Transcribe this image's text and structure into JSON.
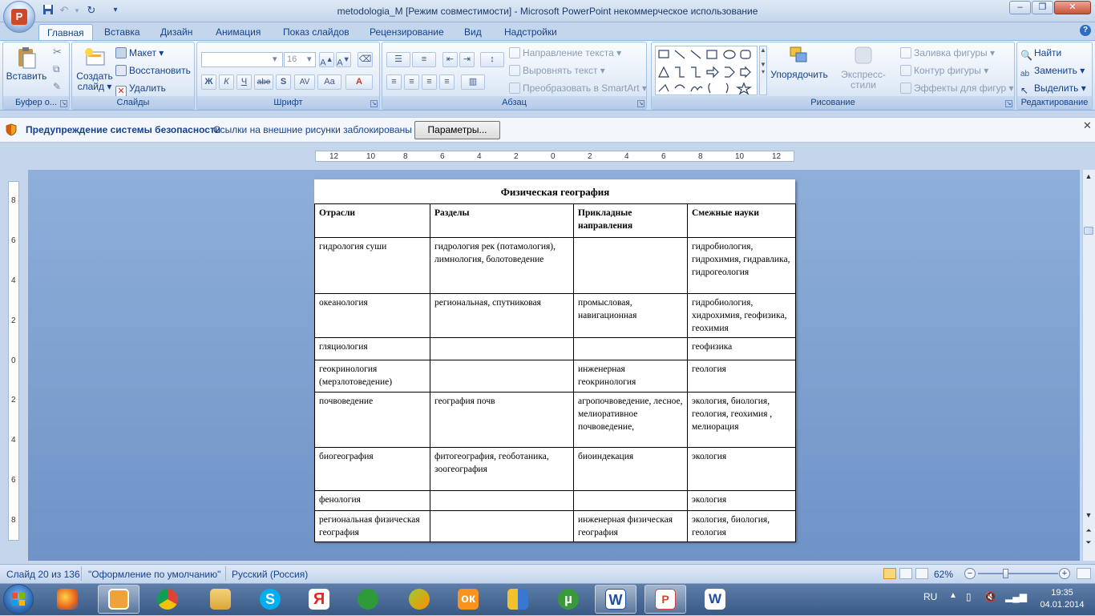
{
  "window": {
    "title": "metodologia_M [Режим совместимости] - Microsoft PowerPoint некоммерческое использование",
    "minimize": "–",
    "maximize": "❐",
    "close": "✕"
  },
  "tabs": [
    "Главная",
    "Вставка",
    "Дизайн",
    "Анимация",
    "Показ слайдов",
    "Рецензирование",
    "Вид",
    "Надстройки"
  ],
  "ribbon": {
    "clipboard": {
      "paste": "Вставить",
      "label": "Буфер о..."
    },
    "slides": {
      "create": "Создать",
      "create2": "слайд ▾",
      "layout": "Макет ▾",
      "reset": "Восстановить",
      "delete": "Удалить",
      "label": "Слайды"
    },
    "font": {
      "size": "16",
      "label": "Шрифт",
      "bold": "Ж",
      "italic": "К",
      "underline": "Ч",
      "strike": "abe",
      "shadow": "S",
      "spacing": "AV",
      "case": "Aa",
      "color": "A"
    },
    "paragraph": {
      "text_direction": "Направление текста ▾",
      "align_text": "Выровнять текст ▾",
      "smartart": "Преобразовать в SmartArt ▾",
      "label": "Абзац"
    },
    "drawing": {
      "arrange": "Упорядочить",
      "quick_styles": "Экспресс-стили",
      "fill": "Заливка фигуры ▾",
      "outline": "Контур фигуры ▾",
      "effects": "Эффекты для фигур ▾",
      "label": "Рисование"
    },
    "editing": {
      "find": "Найти",
      "replace": "Заменить ▾",
      "select": "Выделить ▾",
      "label": "Редактирование"
    }
  },
  "security_bar": {
    "title": "Предупреждение системы безопасности",
    "message": "Ссылки на внешние рисунки заблокированы",
    "button": "Параметры...",
    "close": "✕"
  },
  "ruler": {
    "h_labels": [
      "12",
      "10",
      "8",
      "6",
      "4",
      "2",
      "0",
      "2",
      "4",
      "6",
      "8",
      "10",
      "12"
    ],
    "v_labels": [
      "8",
      "6",
      "4",
      "2",
      "0",
      "2",
      "4",
      "6",
      "8"
    ]
  },
  "slide_table": {
    "title": "Физическая география",
    "headers": [
      "Отрасли",
      "Разделы",
      "Прикладные направления",
      "Смежные науки"
    ],
    "rows": [
      [
        "гидрология суши",
        "гидрология рек (потамология), лимнология, болотоведение",
        "",
        "гидробиология, гидрохимия, гидравлика, гидрогеология"
      ],
      [
        "океанология",
        "региональная, спутниковая",
        "промысловая, навигационная",
        "гидробиология, хидрохимия, геофизика, геохимия"
      ],
      [
        "гляциология",
        "",
        "",
        "геофизика"
      ],
      [
        "геокринология (мерзлотоведение)",
        "",
        "инженерная геокринология",
        "геология"
      ],
      [
        "почвоведение",
        "география почв",
        "агропочвоведение, лесное, мелиоративное почвоведение,",
        "экология, биология, геология, геохимия , мелиорация"
      ],
      [
        "биогеография",
        "фитогеография, геоботаника, зоогеография",
        "биоиндекация",
        "экология"
      ],
      [
        "фенология",
        "",
        "",
        "экология"
      ],
      [
        "региональная физическая география",
        "",
        "инженерная физическая география",
        "экология, биология, геология"
      ]
    ]
  },
  "status": {
    "slide": "Слайд 20 из 136",
    "theme": "\"Оформление по умолчанию\"",
    "language": "Русский (Россия)",
    "zoom": "62%",
    "zoom_level": 0.35
  },
  "taskbar": {
    "lang": "RU",
    "time": "19:35",
    "date": "04.01.2014",
    "apps": [
      "firefox-icon",
      "media-player-icon",
      "chrome-icon",
      "file-explorer-icon",
      "skype-icon",
      "yandex-icon",
      "network-app-icon",
      "toolbox-icon",
      "odnoklassniki-icon",
      "security-shield-icon",
      "utorrent-icon",
      "word-doc-icon",
      "powerpoint-icon",
      "word-icon"
    ]
  }
}
